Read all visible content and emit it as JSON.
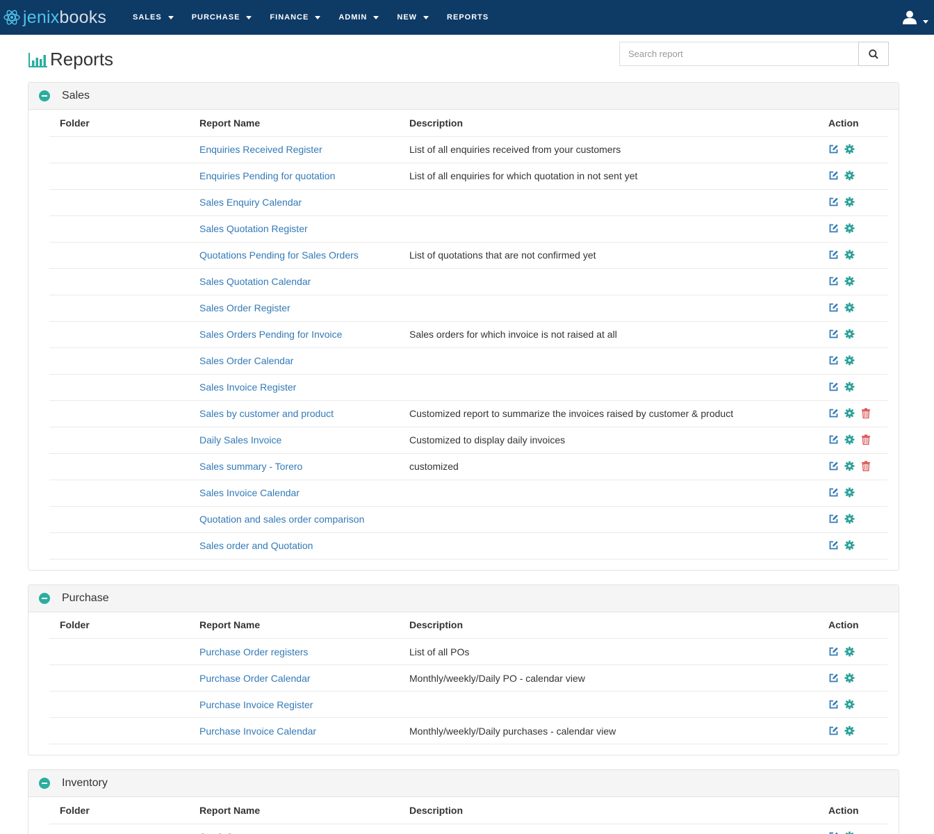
{
  "brand": {
    "part1": "jenix",
    "part2": "books",
    "accent": "#4fc3e8"
  },
  "nav": {
    "items": [
      {
        "label": "SALES",
        "has_caret": true
      },
      {
        "label": "PURCHASE",
        "has_caret": true
      },
      {
        "label": "FINANCE",
        "has_caret": true
      },
      {
        "label": "ADMIN",
        "has_caret": true
      },
      {
        "label": "NEW",
        "has_caret": true
      },
      {
        "label": "REPORTS",
        "has_caret": false
      }
    ],
    "user_icon": "user-icon",
    "background": "#0e3a66"
  },
  "page": {
    "title": "Reports",
    "title_icon": "bar-chart-icon",
    "search": {
      "placeholder": "Search report",
      "value": "",
      "button_icon": "search-icon"
    }
  },
  "table_headers": {
    "folder": "Folder",
    "name": "Report Name",
    "description": "Description",
    "action": "Action"
  },
  "colors": {
    "link": "#337ab7",
    "edit": "#337ab7",
    "settings": "#2aa198",
    "delete": "#d9534f",
    "toggle": "#2bada0"
  },
  "sections": [
    {
      "title": "Sales",
      "rows": [
        {
          "folder": "",
          "name": "Enquiries Received Register",
          "description": "List of all enquiries received from your customers",
          "deletable": false
        },
        {
          "folder": "",
          "name": "Enquiries Pending for quotation",
          "description": "List of all enquiries for which quotation in not sent yet",
          "deletable": false
        },
        {
          "folder": "",
          "name": "Sales Enquiry Calendar",
          "description": "",
          "deletable": false
        },
        {
          "folder": "",
          "name": "Sales Quotation Register",
          "description": "",
          "deletable": false
        },
        {
          "folder": "",
          "name": "Quotations Pending for Sales Orders",
          "description": "List of quotations that are not confirmed yet",
          "deletable": false
        },
        {
          "folder": "",
          "name": "Sales Quotation Calendar",
          "description": "",
          "deletable": false
        },
        {
          "folder": "",
          "name": "Sales Order Register",
          "description": "",
          "deletable": false
        },
        {
          "folder": "",
          "name": "Sales Orders Pending for Invoice",
          "description": "Sales orders for which invoice is not raised at all",
          "deletable": false
        },
        {
          "folder": "",
          "name": "Sales Order Calendar",
          "description": "",
          "deletable": false
        },
        {
          "folder": "",
          "name": "Sales Invoice Register",
          "description": "",
          "deletable": false
        },
        {
          "folder": "",
          "name": "Sales by customer and product",
          "description": "Customized report to summarize the invoices raised by customer & product",
          "deletable": true
        },
        {
          "folder": "",
          "name": "Daily Sales Invoice",
          "description": "Customized to display daily invoices",
          "deletable": true
        },
        {
          "folder": "",
          "name": "Sales summary - Torero",
          "description": "customized",
          "deletable": true
        },
        {
          "folder": "",
          "name": "Sales Invoice Calendar",
          "description": "",
          "deletable": false
        },
        {
          "folder": "",
          "name": "Quotation and sales order comparison",
          "description": "",
          "deletable": false
        },
        {
          "folder": "",
          "name": "Sales order and Quotation",
          "description": "",
          "deletable": false
        }
      ]
    },
    {
      "title": "Purchase",
      "rows": [
        {
          "folder": "",
          "name": "Purchase Order registers",
          "description": "List of all POs",
          "deletable": false
        },
        {
          "folder": "",
          "name": "Purchase Order Calendar",
          "description": "Monthly/weekly/Daily PO - calendar view",
          "deletable": false
        },
        {
          "folder": "",
          "name": "Purchase Invoice Register",
          "description": "",
          "deletable": false
        },
        {
          "folder": "",
          "name": "Purchase Invoice Calendar",
          "description": "Monthly/weekly/Daily purchases - calendar view",
          "deletable": false
        }
      ]
    },
    {
      "title": "Inventory",
      "rows": [
        {
          "folder": "",
          "name": "Stock Statement",
          "description": "",
          "deletable": false
        }
      ]
    }
  ]
}
